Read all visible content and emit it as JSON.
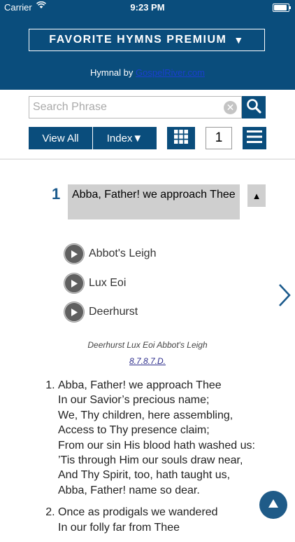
{
  "status": {
    "carrier": "Carrier",
    "time": "9:23 PM"
  },
  "header": {
    "title": "FAVORITE HYMNS PREMIUM",
    "title_arrow": "▼",
    "subtitle_prefix": "Hymnal by ",
    "subtitle_link": "GospelRiver.com"
  },
  "search": {
    "placeholder": "Search Phrase",
    "value": ""
  },
  "toolbar": {
    "view_all": "View All",
    "index": "Index▼",
    "page_number": "1"
  },
  "hymn": {
    "number": "1",
    "title": "Abba, Father! we approach Thee",
    "collapse_glyph": "▲",
    "tunes": [
      "Abbot's Leigh",
      "Lux Eoi",
      "Deerhurst"
    ],
    "meter_tunes": "Deerhurst Lux Eoi Abbot's Leigh",
    "meter": "8.7.8.7.D.",
    "verses": [
      {
        "lines": [
          "Abba, Father! we approach Thee",
          "In our Savior’s precious name;",
          "We, Thy children, here assembling,",
          "Access to Thy presence claim;",
          "From our sin His blood hath washed us:",
          "’Tis through Him our souls draw near,",
          "And Thy Spirit, too, hath taught us,",
          "Abba, Father! name so dear."
        ]
      },
      {
        "lines": [
          "Once as prodigals we wandered",
          "In our folly far from Thee"
        ]
      }
    ]
  },
  "colors": {
    "primary": "#0a4d7c",
    "header_gray": "#cfcfcf",
    "number_blue": "#1b5a8c"
  },
  "icons": {
    "wifi": "wifi-icon",
    "battery": "battery-icon",
    "search": "magnifier-icon",
    "clear": "clear-icon",
    "grid": "grid-icon",
    "menu": "hamburger-icon",
    "play": "play-icon",
    "next": "chevron-right-icon",
    "scroll_top": "up-arrow-icon"
  }
}
